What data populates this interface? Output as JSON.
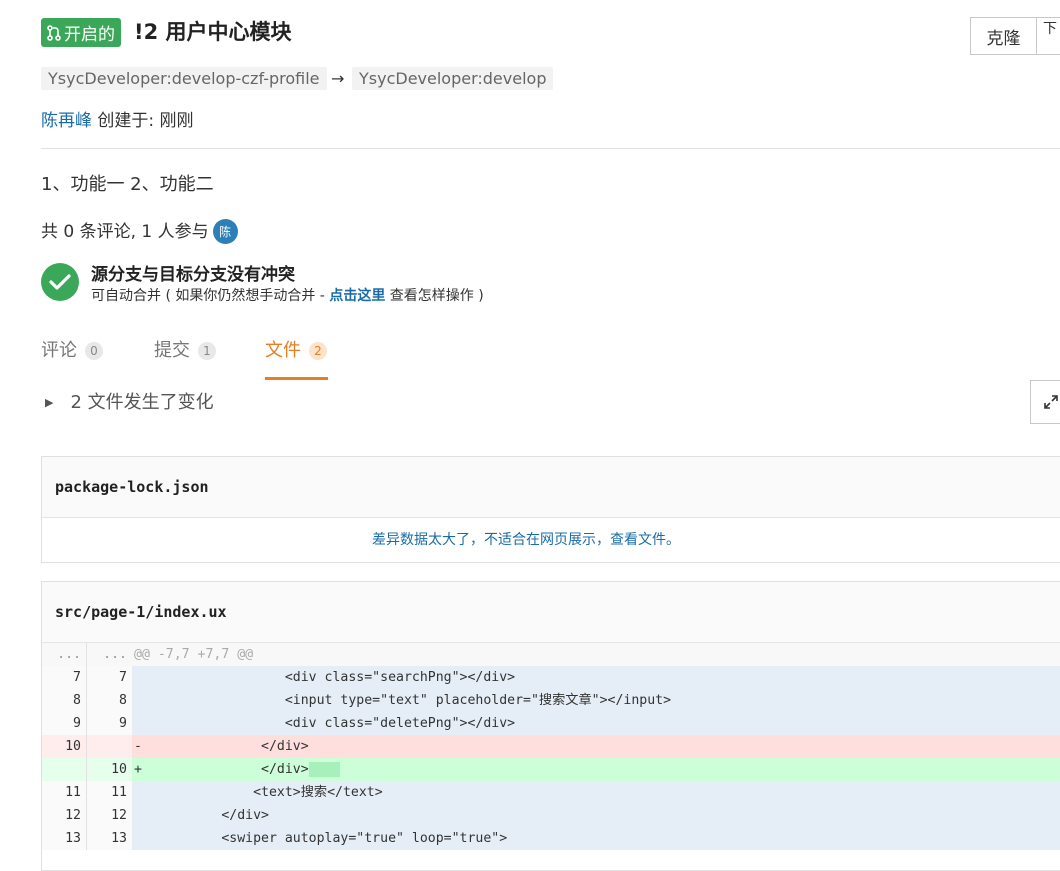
{
  "header": {
    "status_label": "开启的",
    "title": "!2 用户中心模块",
    "clone_label": "克隆",
    "more_label": "下"
  },
  "branches": {
    "source": "YsycDeveloper:develop-czf-profile",
    "arrow": "→",
    "target": "YsycDeveloper:develop"
  },
  "meta": {
    "author": "陈再峰",
    "created_text": " 创建于:  刚刚"
  },
  "description": "1、功能一 2、功能二",
  "stats": {
    "text": "共 0 条评论, 1 人参与",
    "avatar_initial": "陈"
  },
  "merge": {
    "title": "源分支与目标分支没有冲突",
    "sub_prefix": "可自动合并 ( 如果你仍然想手动合并 - ",
    "sub_link": "点击这里",
    "sub_suffix": " 查看怎样操作 )"
  },
  "tabs": [
    {
      "label": "评论",
      "count": "0"
    },
    {
      "label": "提交",
      "count": "1"
    },
    {
      "label": "文件",
      "count": "2"
    }
  ],
  "changes_label": "2 文件发生了变化",
  "files": [
    {
      "name": "package-lock.json",
      "message": "差异数据太大了，不适合在网页展示，查看文件。"
    },
    {
      "name": "src/page-1/index.ux"
    }
  ],
  "diff": {
    "hunk": {
      "left": "...",
      "right": "...",
      "text": "@@ -7,7 +7,7 @@"
    },
    "lines": [
      {
        "left": "7",
        "right": "7",
        "text": "                   <div class=\"searchPng\"></div>"
      },
      {
        "left": "8",
        "right": "8",
        "text": "                   <input type=\"text\" placeholder=\"搜索文章\"></input>"
      },
      {
        "left": "9",
        "right": "9",
        "text": "                   <div class=\"deletePng\"></div>"
      },
      {
        "left": "10",
        "right": "",
        "text": "-               </div>"
      },
      {
        "left": "",
        "right": "10",
        "text": "+               </div>"
      },
      {
        "left": "11",
        "right": "11",
        "text": "               <text>搜索</text>"
      },
      {
        "left": "12",
        "right": "12",
        "text": "           </div>"
      },
      {
        "left": "13",
        "right": "13",
        "text": "           <swiper autoplay=\"true\" loop=\"true\">"
      }
    ]
  }
}
